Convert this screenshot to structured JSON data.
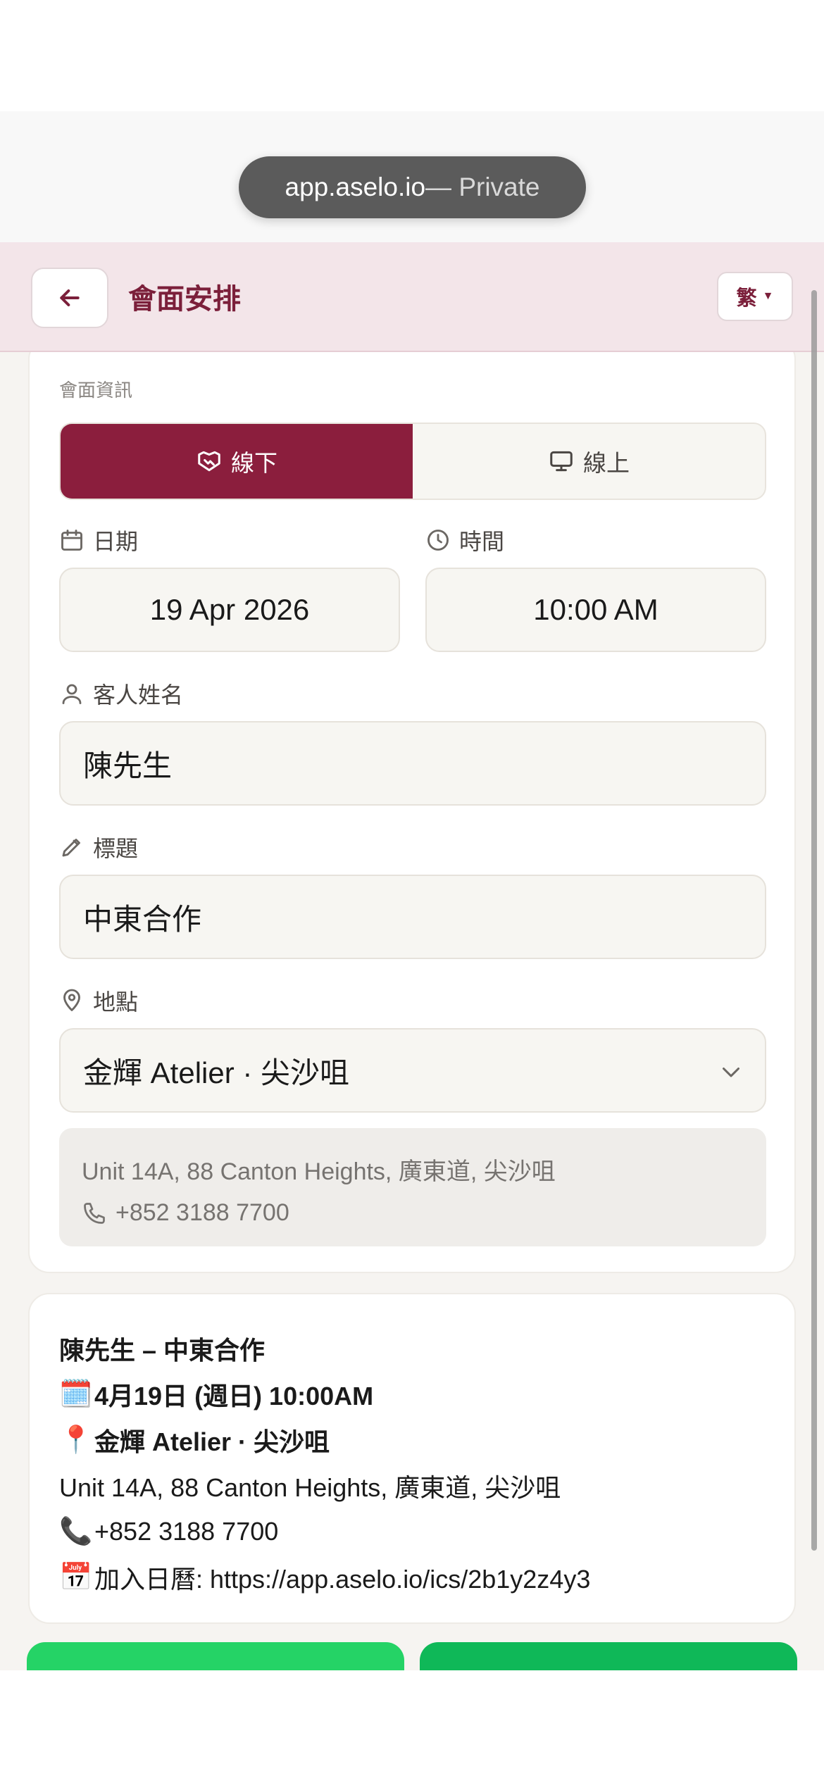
{
  "browser": {
    "url": "app.aselo.io",
    "privacy": " — Private"
  },
  "header": {
    "title": "會面安排",
    "language": "繁"
  },
  "form": {
    "section_label": "會面資訊",
    "mode": {
      "offline": "線下",
      "online": "線上",
      "selected": "offline"
    },
    "date": {
      "label": "日期",
      "value": "19 Apr 2026"
    },
    "time": {
      "label": "時間",
      "value": "10:00 AM"
    },
    "guest": {
      "label": "客人姓名",
      "value": "陳先生"
    },
    "title": {
      "label": "標題",
      "value": "中東合作"
    },
    "location": {
      "label": "地點",
      "value": "金輝 Atelier · 尖沙咀",
      "address": "Unit 14A, 88 Canton Heights, 廣東道, 尖沙咀",
      "phone": "+852 3188 7700"
    }
  },
  "preview": {
    "heading": "陳先生 – 中東合作",
    "datetime": "4月19日 (週日) 10:00AM",
    "place": "金輝 Atelier · 尖沙咀",
    "address": "Unit 14A, 88 Canton Heights, 廣東道, 尖沙咀",
    "phone": "+852 3188 7700",
    "calendar": "加入日曆: https://app.aselo.io/ics/2b1y2z4y3"
  },
  "colors": {
    "brand": "#8b1e3d",
    "header_bg": "#f3e5e9",
    "whatsapp_green": "#25d366"
  }
}
